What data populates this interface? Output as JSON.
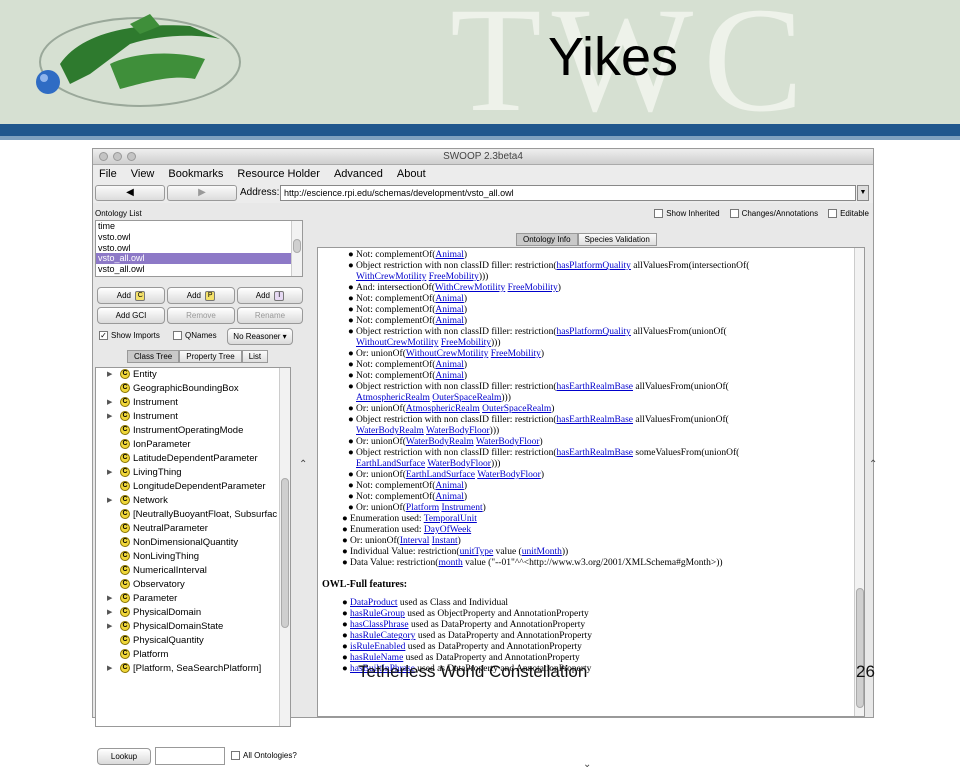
{
  "slide": {
    "title": "Yikes",
    "watermark": "TWC",
    "footer": "Tetherless World Constellation",
    "page": "26"
  },
  "colors": {
    "banner": "#d6e0d2",
    "stripe": "#20578d",
    "selection": "#8d79c7",
    "link": "#0000cc"
  },
  "app": {
    "title": "SWOOP 2.3beta4",
    "menu": [
      "File",
      "View",
      "Bookmarks",
      "Resource Holder",
      "Advanced",
      "About"
    ],
    "back_glyph": "◀",
    "forward_glyph": "▶",
    "address_label": "Address:",
    "address": "http://escience.rpi.edu/schemas/development/vsto_all.owl"
  },
  "left": {
    "ontology_list_title": "Ontology List",
    "ontologies": [
      "time",
      "vsto.owl",
      "vsto.owl",
      "vsto_all.owl",
      "vsto_all.owl"
    ],
    "selected_index": 3,
    "add_c": "Add",
    "add_p": "Add",
    "add_i": "Add",
    "add_c_icon": "C",
    "add_p_icon": "P",
    "add_i_icon": "I",
    "add_gci": "Add GCI",
    "remove": "Remove",
    "rename": "Rename",
    "show_imports": "Show Imports",
    "show_imports_checked": true,
    "qnames": "QNames",
    "qnames_checked": false,
    "reasoner": "No Reasoner",
    "tabs": [
      "Class Tree",
      "Property Tree",
      "List"
    ],
    "active_tab": "Class Tree",
    "tree": [
      {
        "label": "Entity",
        "expandable": true
      },
      {
        "label": "GeographicBoundingBox",
        "expandable": false
      },
      {
        "label": "Instrument",
        "expandable": true
      },
      {
        "label": "Instrument",
        "expandable": true
      },
      {
        "label": "InstrumentOperatingMode",
        "expandable": false
      },
      {
        "label": "IonParameter",
        "expandable": false
      },
      {
        "label": "LatitudeDependentParameter",
        "expandable": false
      },
      {
        "label": "LivingThing",
        "expandable": true
      },
      {
        "label": "LongitudeDependentParameter",
        "expandable": false
      },
      {
        "label": "Network",
        "expandable": true
      },
      {
        "label": "[NeutrallyBuoyantFloat, Subsurfac",
        "expandable": false
      },
      {
        "label": "NeutralParameter",
        "expandable": false
      },
      {
        "label": "NonDimensionalQuantity",
        "expandable": false
      },
      {
        "label": "NonLivingThing",
        "expandable": false
      },
      {
        "label": "NumericalInterval",
        "expandable": false
      },
      {
        "label": "Observatory",
        "expandable": false
      },
      {
        "label": "Parameter",
        "expandable": true
      },
      {
        "label": "PhysicalDomain",
        "expandable": true
      },
      {
        "label": "PhysicalDomainState",
        "expandable": true
      },
      {
        "label": "PhysicalQuantity",
        "expandable": false
      },
      {
        "label": "Platform",
        "expandable": false
      },
      {
        "label": "[Platform, SeaSearchPlatform]",
        "expandable": true
      }
    ],
    "lookup": "Lookup",
    "all_ontologies": "All Ontologies?"
  },
  "right": {
    "show_inherited": "Show Inherited",
    "changes": "Changes/Annotations",
    "editable": "Editable",
    "tabs": [
      "Ontology Info",
      "Species Validation"
    ],
    "active_tab": "Ontology Info",
    "lines": [
      {
        "b": "●",
        "sub": true,
        "parts": [
          [
            "Not: complementOf(",
            ""
          ],
          [
            "Animal",
            "l"
          ],
          [
            ")",
            ""
          ]
        ]
      },
      {
        "b": "●",
        "sub": true,
        "parts": [
          [
            "Object restriction with non classID filler: restriction(",
            ""
          ],
          [
            "hasPlatformQuality",
            "l"
          ],
          [
            " allValuesFrom(intersectionOf(",
            ""
          ]
        ]
      },
      {
        "b": "",
        "sub": true,
        "parts": [
          [
            "WithCrewMotility",
            "l"
          ],
          [
            " ",
            ""
          ],
          [
            "FreeMobility",
            "l"
          ],
          [
            ")))",
            ""
          ]
        ]
      },
      {
        "b": "●",
        "sub": true,
        "parts": [
          [
            "And: intersectionOf(",
            ""
          ],
          [
            "WithCrewMotility",
            "l"
          ],
          [
            " ",
            ""
          ],
          [
            "FreeMobility",
            "l"
          ],
          [
            ")",
            ""
          ]
        ]
      },
      {
        "b": "●",
        "sub": true,
        "parts": [
          [
            "Not: complementOf(",
            ""
          ],
          [
            "Animal",
            "l"
          ],
          [
            ")",
            ""
          ]
        ]
      },
      {
        "b": "●",
        "sub": true,
        "parts": [
          [
            "Not: complementOf(",
            ""
          ],
          [
            "Animal",
            "l"
          ],
          [
            ")",
            ""
          ]
        ]
      },
      {
        "b": "●",
        "sub": true,
        "parts": [
          [
            "Not: complementOf(",
            ""
          ],
          [
            "Animal",
            "l"
          ],
          [
            ")",
            ""
          ]
        ]
      },
      {
        "b": "●",
        "sub": true,
        "parts": [
          [
            "Object restriction with non classID filler: restriction(",
            ""
          ],
          [
            "hasPlatformQuality",
            "l"
          ],
          [
            " allValuesFrom(unionOf(",
            ""
          ]
        ]
      },
      {
        "b": "",
        "sub": true,
        "parts": [
          [
            "WithoutCrewMotility",
            "l"
          ],
          [
            " ",
            ""
          ],
          [
            "FreeMobility",
            "l"
          ],
          [
            ")))",
            ""
          ]
        ]
      },
      {
        "b": "●",
        "sub": true,
        "parts": [
          [
            "Or: unionOf(",
            ""
          ],
          [
            "WithoutCrewMotility",
            "l"
          ],
          [
            " ",
            ""
          ],
          [
            "FreeMobility",
            "l"
          ],
          [
            ")",
            ""
          ]
        ]
      },
      {
        "b": "●",
        "sub": true,
        "parts": [
          [
            "Not: complementOf(",
            ""
          ],
          [
            "Animal",
            "l"
          ],
          [
            ")",
            ""
          ]
        ]
      },
      {
        "b": "●",
        "sub": true,
        "parts": [
          [
            "Not: complementOf(",
            ""
          ],
          [
            "Animal",
            "l"
          ],
          [
            ")",
            ""
          ]
        ]
      },
      {
        "b": "●",
        "sub": true,
        "parts": [
          [
            "Object restriction with non classID filler: restriction(",
            ""
          ],
          [
            "hasEarthRealmBase",
            "l"
          ],
          [
            " allValuesFrom(unionOf(",
            ""
          ]
        ]
      },
      {
        "b": "",
        "sub": true,
        "parts": [
          [
            "AtmosphericRealm",
            "l"
          ],
          [
            " ",
            ""
          ],
          [
            "OuterSpaceRealm",
            "l"
          ],
          [
            ")))",
            ""
          ]
        ]
      },
      {
        "b": "●",
        "sub": true,
        "parts": [
          [
            "Or: unionOf(",
            ""
          ],
          [
            "AtmosphericRealm",
            "l"
          ],
          [
            " ",
            ""
          ],
          [
            "OuterSpaceRealm",
            "l"
          ],
          [
            ")",
            ""
          ]
        ]
      },
      {
        "b": "●",
        "sub": true,
        "parts": [
          [
            "Object restriction with non classID filler: restriction(",
            ""
          ],
          [
            "hasEarthRealmBase",
            "l"
          ],
          [
            " allValuesFrom(unionOf(",
            ""
          ]
        ]
      },
      {
        "b": "",
        "sub": true,
        "parts": [
          [
            "WaterBodyRealm",
            "l"
          ],
          [
            " ",
            ""
          ],
          [
            "WaterBodyFloor",
            "l"
          ],
          [
            ")))",
            ""
          ]
        ]
      },
      {
        "b": "●",
        "sub": true,
        "parts": [
          [
            "Or: unionOf(",
            ""
          ],
          [
            "WaterBodyRealm",
            "l"
          ],
          [
            " ",
            ""
          ],
          [
            "WaterBodyFloor",
            "l"
          ],
          [
            ")",
            ""
          ]
        ]
      },
      {
        "b": "●",
        "sub": true,
        "parts": [
          [
            "Object restriction with non classID filler: restriction(",
            ""
          ],
          [
            "hasEarthRealmBase",
            "l"
          ],
          [
            " someValuesFrom(unionOf(",
            ""
          ]
        ]
      },
      {
        "b": "",
        "sub": true,
        "parts": [
          [
            "EarthLandSurface",
            "l"
          ],
          [
            " ",
            ""
          ],
          [
            "WaterBodyFloor",
            "l"
          ],
          [
            ")))",
            ""
          ]
        ]
      },
      {
        "b": "●",
        "sub": true,
        "parts": [
          [
            "Or: unionOf(",
            ""
          ],
          [
            "EarthLandSurface",
            "l"
          ],
          [
            " ",
            ""
          ],
          [
            "WaterBodyFloor",
            "l"
          ],
          [
            ")",
            ""
          ]
        ]
      },
      {
        "b": "●",
        "sub": true,
        "parts": [
          [
            "Not: complementOf(",
            ""
          ],
          [
            "Animal",
            "l"
          ],
          [
            ")",
            ""
          ]
        ]
      },
      {
        "b": "●",
        "sub": true,
        "parts": [
          [
            "Not: complementOf(",
            ""
          ],
          [
            "Animal",
            "l"
          ],
          [
            ")",
            ""
          ]
        ]
      },
      {
        "b": "●",
        "sub": true,
        "parts": [
          [
            "Or: unionOf(",
            ""
          ],
          [
            "Platform",
            "l"
          ],
          [
            " ",
            ""
          ],
          [
            "Instrument",
            "l"
          ],
          [
            ")",
            ""
          ]
        ]
      },
      {
        "b": "●",
        "sub": false,
        "parts": [
          [
            "Enumeration used: ",
            ""
          ],
          [
            "TemporalUnit",
            "l"
          ]
        ]
      },
      {
        "b": "●",
        "sub": false,
        "parts": [
          [
            "Enumeration used: ",
            ""
          ],
          [
            "DayOfWeek",
            "l"
          ]
        ]
      },
      {
        "b": "●",
        "sub": false,
        "parts": [
          [
            "Or: unionOf(",
            ""
          ],
          [
            "Interval",
            "l"
          ],
          [
            " ",
            ""
          ],
          [
            "Instant",
            "l"
          ],
          [
            ")",
            ""
          ]
        ]
      },
      {
        "b": "●",
        "sub": false,
        "parts": [
          [
            "Individual Value: restriction(",
            ""
          ],
          [
            "unitType",
            "l"
          ],
          [
            " value (",
            ""
          ],
          [
            "unitMonth",
            "l"
          ],
          [
            "))",
            ""
          ]
        ]
      },
      {
        "b": "●",
        "sub": false,
        "parts": [
          [
            "Data Value: restriction(",
            ""
          ],
          [
            "month",
            "l"
          ],
          [
            " value (\"--01\"^^<http://www.w3.org/2001/XMLSchema#gMonth>))",
            ""
          ]
        ]
      }
    ],
    "owl_full_heading": "OWL-Full features:",
    "owl_full": [
      {
        "parts": [
          [
            "DataProduct",
            "l"
          ],
          [
            " used as Class and Individual",
            ""
          ]
        ]
      },
      {
        "parts": [
          [
            "hasRuleGroup",
            "l"
          ],
          [
            " used as ObjectProperty and AnnotationProperty",
            ""
          ]
        ]
      },
      {
        "parts": [
          [
            "hasClassPhrase",
            "l"
          ],
          [
            " used as DataProperty and AnnotationProperty",
            ""
          ]
        ]
      },
      {
        "parts": [
          [
            "hasRuleCategory",
            "l"
          ],
          [
            " used as DataProperty and AnnotationProperty",
            ""
          ]
        ]
      },
      {
        "parts": [
          [
            "isRuleEnabled",
            "l"
          ],
          [
            " used as DataProperty and AnnotationProperty",
            ""
          ]
        ]
      },
      {
        "parts": [
          [
            "hasRuleName",
            "l"
          ],
          [
            " used as DataProperty and AnnotationProperty",
            ""
          ]
        ]
      },
      {
        "parts": [
          [
            "hasBuiltInPhrase",
            "l"
          ],
          [
            " used as DataProperty and AnnotationProperty",
            ""
          ]
        ]
      }
    ]
  }
}
